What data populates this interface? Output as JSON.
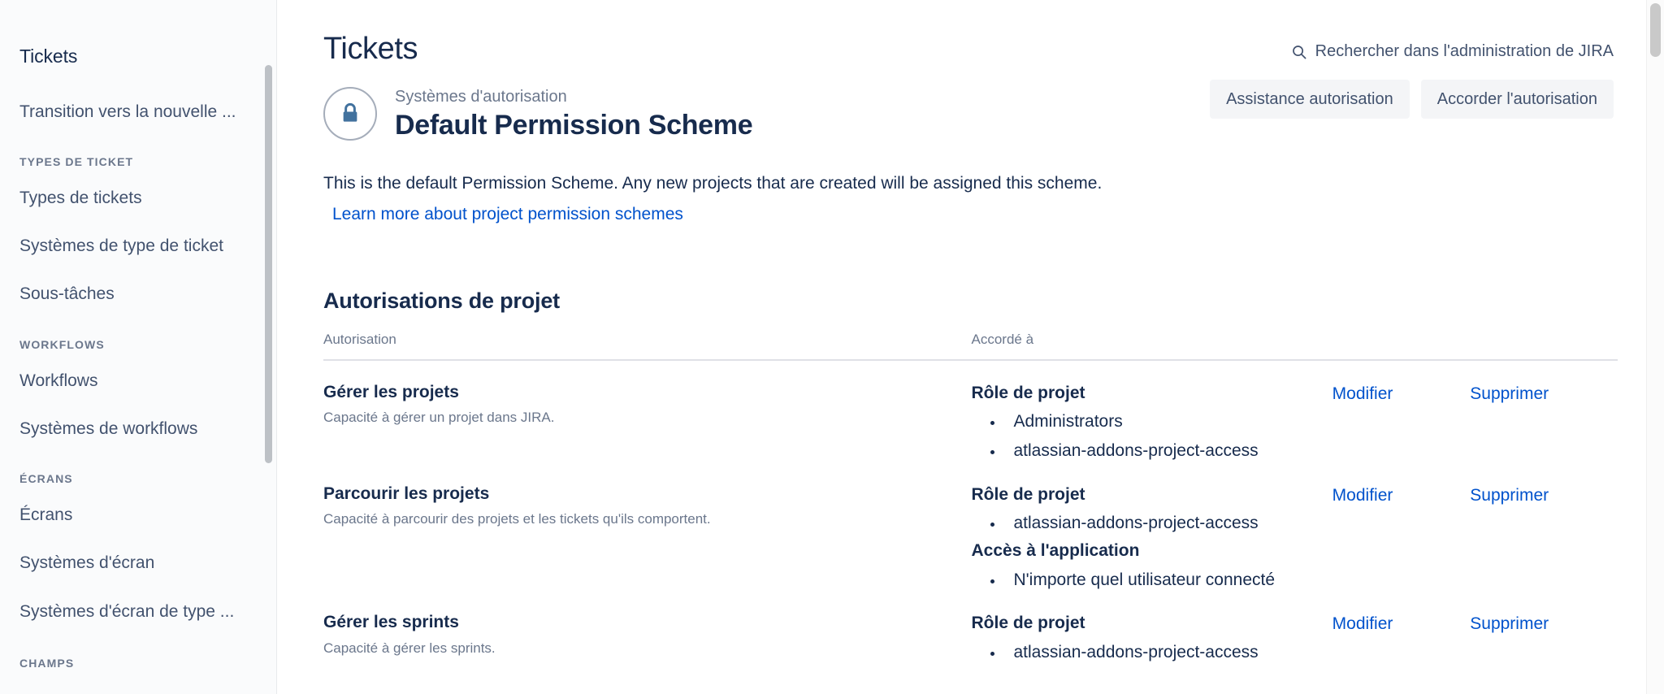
{
  "sidebar": {
    "title": "Tickets",
    "items": [
      {
        "label": "Transition vers la nouvelle ...",
        "name": "sidebar-item-transition"
      }
    ],
    "groups": [
      {
        "heading": "TYPES DE TICKET",
        "items": [
          {
            "label": "Types de tickets",
            "name": "sidebar-item-types-de-tickets"
          },
          {
            "label": "Systèmes de type de ticket",
            "name": "sidebar-item-systemes-de-type-de-ticket"
          },
          {
            "label": "Sous-tâches",
            "name": "sidebar-item-sous-taches"
          }
        ]
      },
      {
        "heading": "WORKFLOWS",
        "items": [
          {
            "label": "Workflows",
            "name": "sidebar-item-workflows"
          },
          {
            "label": "Systèmes de workflows",
            "name": "sidebar-item-systemes-de-workflows"
          }
        ]
      },
      {
        "heading": "ÉCRANS",
        "items": [
          {
            "label": "Écrans",
            "name": "sidebar-item-ecrans"
          },
          {
            "label": "Systèmes d'écran",
            "name": "sidebar-item-systemes-decran"
          },
          {
            "label": "Systèmes d'écran de type ...",
            "name": "sidebar-item-systemes-decran-de-type"
          }
        ]
      }
    ],
    "cut_off_heading": "CHAMPS"
  },
  "header": {
    "page_title": "Tickets",
    "search_label": "Rechercher dans l'administration de JIRA",
    "search_icon": "search-icon"
  },
  "scheme": {
    "icon": "lock-icon",
    "eyebrow": "Systèmes d'autorisation",
    "name": "Default Permission Scheme",
    "actions": [
      {
        "label": "Assistance autorisation",
        "name": "permission-helper-button"
      },
      {
        "label": "Accorder l'autorisation",
        "name": "grant-permission-button"
      }
    ]
  },
  "intro": {
    "text": "This is the default Permission Scheme. Any new projects that are created will be assigned this scheme.",
    "link": "Learn more about project permission schemes"
  },
  "permissions_section": {
    "title": "Autorisations de projet",
    "columns": {
      "permission": "Autorisation",
      "granted_to": "Accordé à",
      "edit": "",
      "delete": ""
    },
    "actions": {
      "edit": "Modifier",
      "delete": "Supprimer"
    },
    "rows": [
      {
        "name": "Gérer les projets",
        "description": "Capacité à gérer un projet dans JIRA.",
        "grants": [
          {
            "type": "Rôle de projet",
            "entries": [
              "Administrators",
              "atlassian-addons-project-access"
            ]
          }
        ]
      },
      {
        "name": "Parcourir les projets",
        "description": "Capacité à parcourir des projets et les tickets qu'ils comportent.",
        "grants": [
          {
            "type": "Rôle de projet",
            "entries": [
              "atlassian-addons-project-access"
            ]
          },
          {
            "type": "Accès à l'application",
            "entries": [
              "N'importe quel utilisateur connecté"
            ]
          }
        ]
      },
      {
        "name": "Gérer les sprints",
        "description": "Capacité à gérer les sprints.",
        "grants": [
          {
            "type": "Rôle de projet",
            "entries": [
              "atlassian-addons-project-access"
            ]
          }
        ]
      }
    ]
  },
  "colors": {
    "link": "#0052cc",
    "text": "#172b4d",
    "muted": "#6b778c",
    "sidebar_bg": "#fafbfc",
    "button_bg": "#f4f5f7"
  }
}
